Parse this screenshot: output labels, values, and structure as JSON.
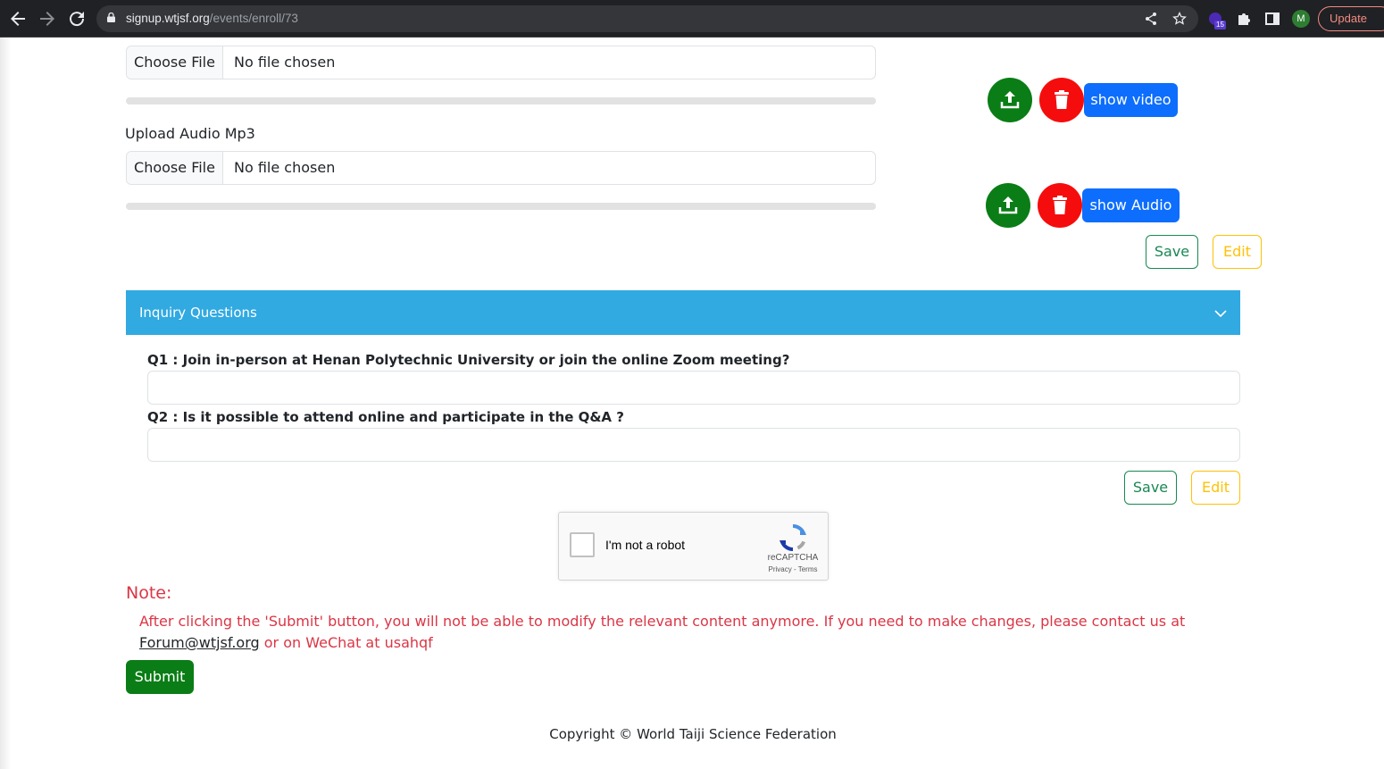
{
  "browser": {
    "url_host": "signup.wtjsf.org",
    "url_path": "/events/enroll/73",
    "extension_badge": "15",
    "profile_initial": "M",
    "update_label": "Update"
  },
  "video_upload": {
    "choose_label": "Choose File",
    "status": "No file chosen",
    "show_label": "show video"
  },
  "audio_upload": {
    "label": "Upload Audio Mp3",
    "choose_label": "Choose File",
    "status": "No file chosen",
    "show_label": "show Audio"
  },
  "media_actions": {
    "save_label": "Save",
    "edit_label": "Edit"
  },
  "inquiry": {
    "title": "Inquiry Questions",
    "questions": [
      {
        "label": "Q1 : Join in-person at Henan Polytechnic University or join the online Zoom meeting?",
        "value": ""
      },
      {
        "label": "Q2 : Is it possible to attend online and participate in the Q&A  ?",
        "value": ""
      }
    ],
    "save_label": "Save",
    "edit_label": "Edit"
  },
  "captcha": {
    "label": "I'm not a robot",
    "brand": "reCAPTCHA",
    "links": "Privacy - Terms"
  },
  "note": {
    "title": "Note:",
    "text_before": "After clicking the 'Submit' button, you will not be able to modify the relevant content anymore. If you need to make changes, please contact us at ",
    "email": "Forum@wtjsf.org",
    "text_after": " or on WeChat at usahqf"
  },
  "submit_label": "Submit",
  "footer": "Copyright © World Taiji Science Federation",
  "colors": {
    "accordion": "#31a9e1",
    "success": "#0a7d16",
    "danger": "#f50d0d",
    "primary": "#0d6efd",
    "warning": "#ffc107",
    "note": "#dc3545"
  }
}
